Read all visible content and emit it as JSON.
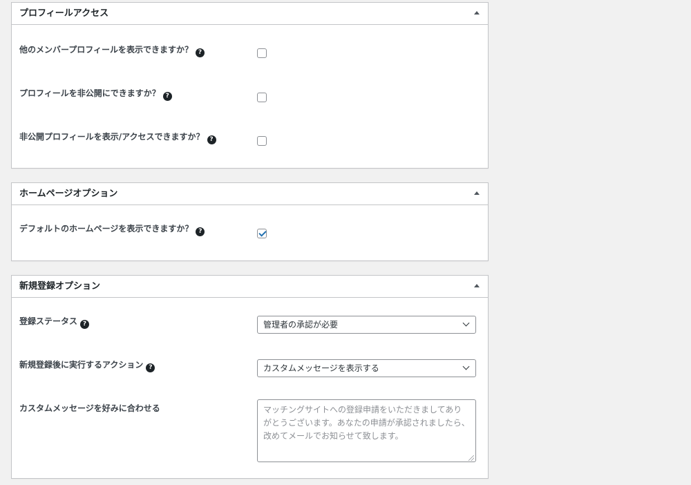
{
  "sections": [
    {
      "title": "プロフィールアクセス",
      "fields": [
        {
          "label": "他のメンバープロフィールを表示できますか？",
          "checked": false
        },
        {
          "label": "プロフィールを非公開にできますか？",
          "checked": false
        },
        {
          "label": "非公開プロフィールを表示/アクセスできますか？",
          "checked": false
        }
      ]
    },
    {
      "title": "ホームページオプション",
      "fields": [
        {
          "label": "デフォルトのホームページを表示できますか？",
          "checked": true
        }
      ]
    },
    {
      "title": "新規登録オプション",
      "fields": [
        {
          "label": "登録ステータス",
          "value": "管理者の承認が必要"
        },
        {
          "label": "新規登録後に実行するアクション",
          "value": "カスタムメッセージを表示する"
        },
        {
          "label": "カスタムメッセージを好みに合わせる",
          "value": "マッチングサイトへの登録申請をいただきましてありがとうございます。あなたの申請が承認されましたら、改めてメールでお知らせて致します。"
        }
      ]
    }
  ],
  "icons": {
    "help": "?",
    "toggle": "arrow-up",
    "select_arrow": "chevron-down"
  },
  "colors": {
    "accent": "#2271b1",
    "border": "#c3c4c7",
    "background": "#f1f1f1"
  }
}
